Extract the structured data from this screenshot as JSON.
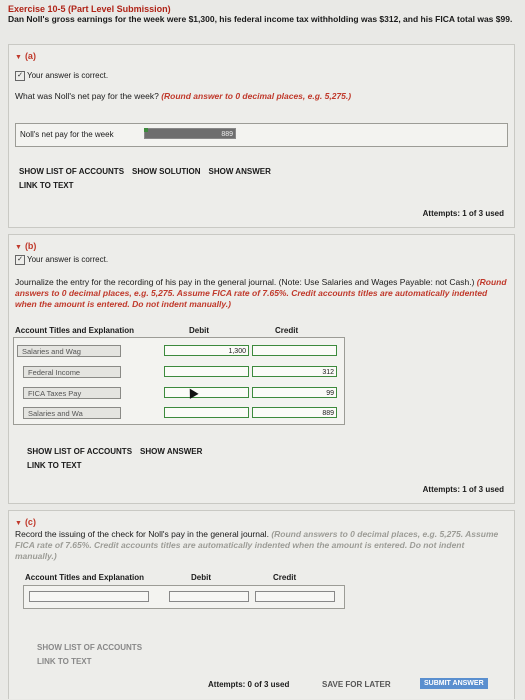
{
  "exercise": {
    "title": "Exercise 10-5 (Part Level Submission)",
    "question": "Dan Noll's gross earnings for the week were $1,300, his federal income tax withholding was $312, and his FICA total was $99."
  },
  "part_a": {
    "label": "(a)",
    "status": "Your answer is correct.",
    "question": "What was Noll's net pay for the week?",
    "hint": "(Round answer to 0 decimal places, e.g. 5,275.)",
    "field_label": "Noll's net pay for the week",
    "net_pay": "889",
    "buttons": [
      "SHOW LIST OF ACCOUNTS",
      "SHOW SOLUTION",
      "SHOW ANSWER",
      "LINK TO TEXT"
    ],
    "attempts": "Attempts: 1 of 3 used"
  },
  "part_b": {
    "label": "(b)",
    "status": "Your answer is correct.",
    "question": "Journalize the entry for the recording of his pay in the general journal. (Note: Use Salaries and Wages Payable: not Cash.)",
    "hint": "(Round answers to 0 decimal places, e.g. 5,275. Assume FICA rate of 7.65%. Credit accounts titles are automatically indented when the amount is entered. Do not indent manually.)",
    "col_account": "Account Titles and Explanation",
    "col_debit": "Debit",
    "col_credit": "Credit",
    "rows": [
      {
        "account": "Salaries and Wag",
        "debit": "1,300",
        "credit": ""
      },
      {
        "account": "Federal Income",
        "debit": "",
        "credit": "312"
      },
      {
        "account": "FICA Taxes Pay",
        "debit": "",
        "credit": "99"
      },
      {
        "account": "Salaries and Wa",
        "debit": "",
        "credit": "889"
      }
    ],
    "buttons": [
      "SHOW LIST OF ACCOUNTS",
      "SHOW ANSWER",
      "LINK TO TEXT"
    ],
    "attempts": "Attempts: 1 of 3 used"
  },
  "part_c": {
    "label": "(c)",
    "question": "Record the issuing of the check for Noll's pay in the general journal.",
    "hint": "(Round answers to 0 decimal places, e.g. 5,275. Assume FICA rate of 7.65%. Credit accounts titles are automatically indented when the amount is entered. Do not indent manually.)",
    "col_account": "Account Titles and Explanation",
    "col_debit": "Debit",
    "col_credit": "Credit",
    "buttons": [
      "SHOW LIST OF ACCOUNTS",
      "LINK TO TEXT"
    ],
    "attempts": "Attempts: 0 of 3 used",
    "save": "SAVE FOR LATER",
    "submit": "SUBMIT ANSWER"
  }
}
